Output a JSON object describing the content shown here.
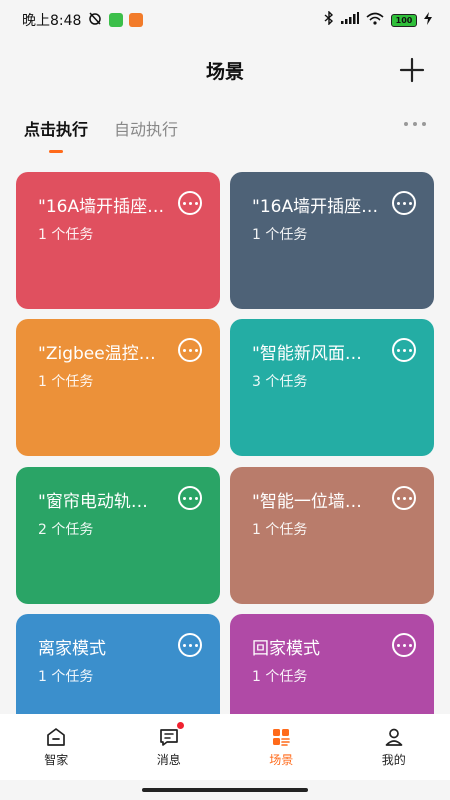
{
  "status_bar": {
    "time": "晚上8:48",
    "battery": "100"
  },
  "header": {
    "title": "场景"
  },
  "tabs": [
    {
      "label": "点击执行",
      "active": true
    },
    {
      "label": "自动执行",
      "active": false
    }
  ],
  "cards": [
    {
      "title": "\"16A墙开插座…",
      "subtitle": "1 个任务",
      "color": "#e0505f"
    },
    {
      "title": "\"16A墙开插座…",
      "subtitle": "1 个任务",
      "color": "#4e6277"
    },
    {
      "title": "\"Zigbee温控…",
      "subtitle": "1 个任务",
      "color": "#ec9139"
    },
    {
      "title": "\"智能新风面…",
      "subtitle": "3 个任务",
      "color": "#24ada4"
    },
    {
      "title": "\"窗帘电动轨…",
      "subtitle": "2 个任务",
      "color": "#2aa466"
    },
    {
      "title": "\"智能一位墙…",
      "subtitle": "1 个任务",
      "color": "#b97c6b"
    },
    {
      "title": "离家模式",
      "subtitle": "1 个任务",
      "color": "#3b8fcc"
    },
    {
      "title": "回家模式",
      "subtitle": "1 个任务",
      "color": "#b04aa6"
    }
  ],
  "bottom_nav": [
    {
      "label": "智家",
      "icon": "home-icon",
      "active": false
    },
    {
      "label": "消息",
      "icon": "message-icon",
      "active": false,
      "badge": true
    },
    {
      "label": "场景",
      "icon": "scene-icon",
      "active": true
    },
    {
      "label": "我的",
      "icon": "profile-icon",
      "active": false
    }
  ],
  "colors": {
    "accent": "#ff6a1a",
    "badge": "#f0212f"
  }
}
